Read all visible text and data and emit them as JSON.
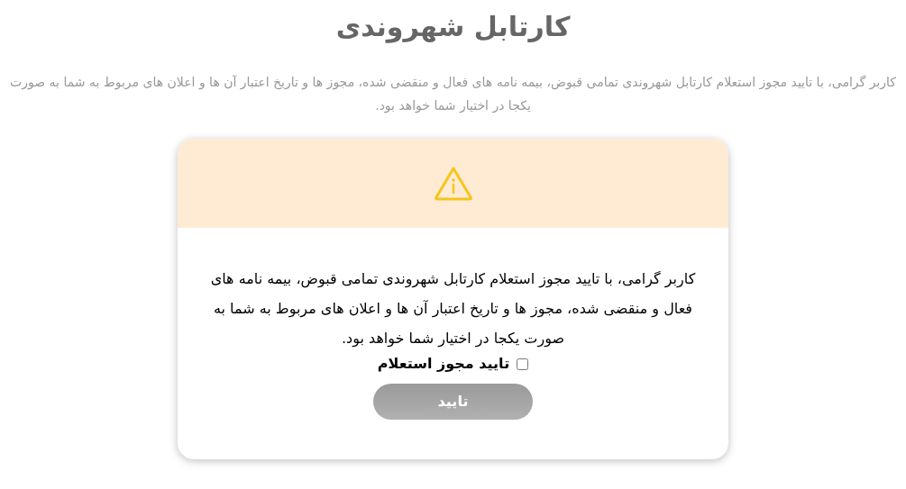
{
  "title": "کارتابل شهروندی",
  "intro": "کاربر گرامی، با تایید مجوز استعلام کارتابل شهروندی تمامی قبوض، بیمه نامه های فعال و منقضی شده، مجوز ها و تاریخ اعتبار آن ها و اعلان های مربوط به شما به صورت یکجا در اختیار شما خواهد بود.",
  "dialog": {
    "message": "کاربر گرامی، با تایید مجوز استعلام کارتابل شهروندی تمامی قبوض، بیمه نامه های فعال و منقضی شده، مجوز ها و تاریخ اعتبار آن ها و اعلان های مربوط به شما به صورت یکجا در اختیار شما خواهد بود.",
    "consent": {
      "label": "تایید مجوز استعلام",
      "checked": false
    },
    "confirm_button": {
      "label": "تایید",
      "disabled": true
    }
  }
}
